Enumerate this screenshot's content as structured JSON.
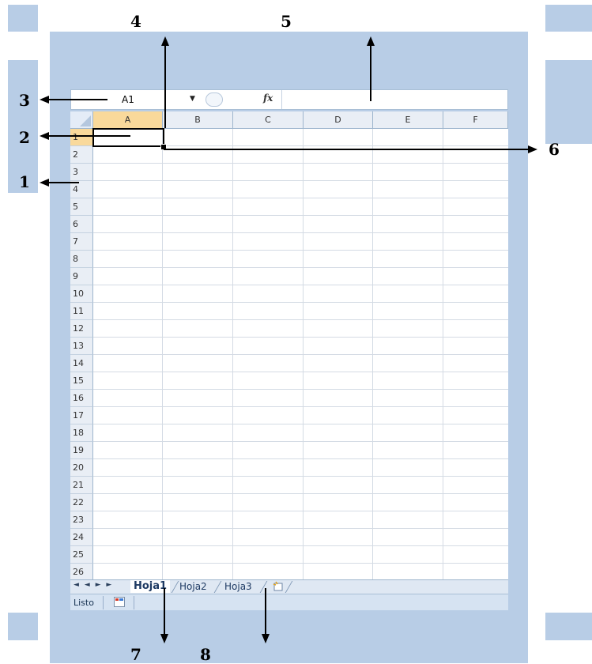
{
  "formula_bar": {
    "name_box": "A1",
    "fx_label": "fx",
    "formula_value": ""
  },
  "columns": [
    "A",
    "B",
    "C",
    "D",
    "E",
    "F"
  ],
  "rows": [
    "1",
    "2",
    "3",
    "4",
    "5",
    "6",
    "7",
    "8",
    "9",
    "10",
    "11",
    "12",
    "13",
    "14",
    "15",
    "16",
    "17",
    "18",
    "19",
    "20",
    "21",
    "22",
    "23",
    "24",
    "25",
    "26"
  ],
  "selected_cell": "A1",
  "sheet_tabs": {
    "nav_buttons": "◄ ◄ ► ►",
    "tabs": [
      "Hoja1",
      "Hoja2",
      "Hoja3"
    ],
    "active": "Hoja1"
  },
  "status_bar": {
    "text": "Listo"
  },
  "callouts": {
    "n1": "1",
    "n2": "2",
    "n3": "3",
    "n4": "4",
    "n5": "5",
    "n6": "6",
    "n7": "7",
    "n8": "8"
  },
  "colors": {
    "frame": "#b8cde6",
    "selected_header": "#f9d99b",
    "header": "#e9eef5"
  }
}
